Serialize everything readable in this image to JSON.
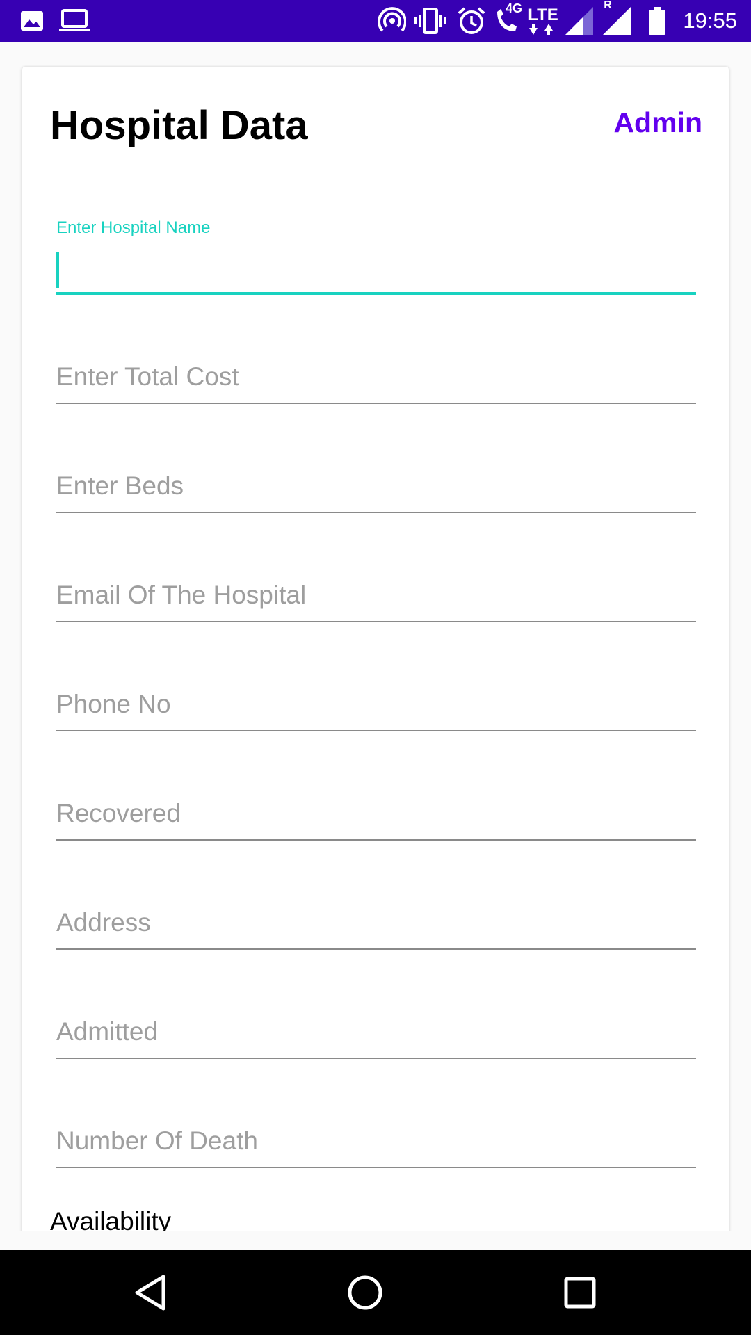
{
  "status_bar": {
    "time": "19:55",
    "network_label": "4G",
    "lte_label": "LTE",
    "roaming_label": "R",
    "icons": [
      "image-icon",
      "laptop-icon",
      "hotspot-icon",
      "vibrate-icon",
      "alarm-icon",
      "wifi-call-icon",
      "lte-icon",
      "signal-icon",
      "signal-roaming-icon",
      "battery-icon"
    ]
  },
  "card": {
    "title": "Hospital Data",
    "admin_label": "Admin"
  },
  "form": {
    "hospital_name": {
      "label": "Enter Hospital Name",
      "value": ""
    },
    "total_cost": {
      "placeholder": "Enter Total Cost"
    },
    "beds": {
      "placeholder": "Enter Beds"
    },
    "email": {
      "placeholder": "Email Of The Hospital"
    },
    "phone": {
      "placeholder": "Phone No"
    },
    "recovered": {
      "placeholder": "Recovered"
    },
    "address": {
      "placeholder": "Address"
    },
    "admitted": {
      "placeholder": "Admitted"
    },
    "deaths": {
      "placeholder": "Number Of Death"
    },
    "availability_label": "Availability"
  },
  "colors": {
    "status_bar": "#3700b3",
    "accent": "#18d2c0",
    "admin": "#6200ee"
  }
}
